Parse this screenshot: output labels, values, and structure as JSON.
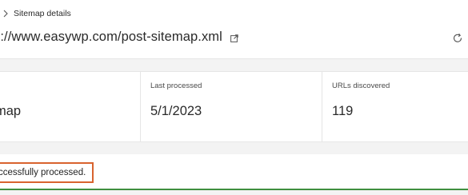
{
  "breadcrumb": {
    "current": "Sitemap details"
  },
  "header": {
    "url": "s://www.easywp.com/post-sitemap.xml"
  },
  "icons": {
    "breadcrumb_separator": "chevron-right-icon",
    "open_link": "open-in-new-icon",
    "refresh": "refresh-icon"
  },
  "stats": {
    "type_value": "map",
    "last_processed_label": "Last processed",
    "last_processed_value": "5/1/2023",
    "urls_label": "URLs discovered",
    "urls_value": "119"
  },
  "status": {
    "message": "ccessfully processed."
  },
  "colors": {
    "highlight_border": "#d8632e",
    "success_line": "#3f8f3f"
  }
}
